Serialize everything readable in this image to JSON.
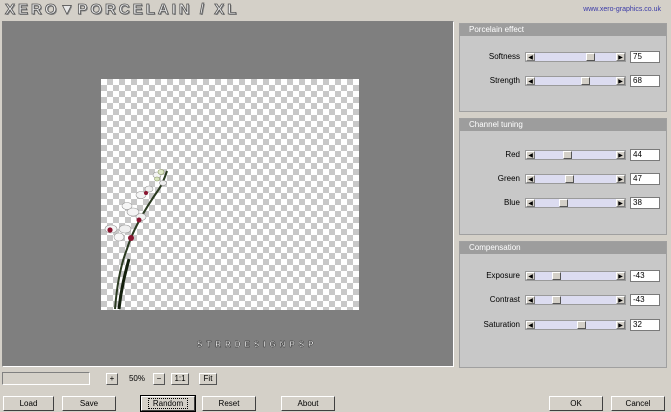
{
  "header": {
    "logo": "XERO▼PORCELAIN / XL",
    "url": "www.xero-graphics.co.uk"
  },
  "preview": {
    "signature": "STRRDESIGNPSP"
  },
  "panels": {
    "porcelain": {
      "title": "Porcelain effect",
      "controls": [
        {
          "label": "Softness",
          "value": "75"
        },
        {
          "label": "Strength",
          "value": "68"
        }
      ]
    },
    "channel": {
      "title": "Channel tuning",
      "controls": [
        {
          "label": "Red",
          "value": "44"
        },
        {
          "label": "Green",
          "value": "47"
        },
        {
          "label": "Blue",
          "value": "38"
        }
      ]
    },
    "compensation": {
      "title": "Compensation",
      "controls": [
        {
          "label": "Exposure",
          "value": "-43"
        },
        {
          "label": "Contrast",
          "value": "-43"
        },
        {
          "label": "Saturation",
          "value": "32"
        }
      ]
    }
  },
  "zoom": {
    "plus": "+",
    "value": "50%",
    "minus": "−",
    "one_to_one": "1:1",
    "fit": "Fit"
  },
  "buttons": {
    "load": "Load",
    "save": "Save",
    "random": "Random",
    "reset": "Reset",
    "about": "About",
    "ok": "OK",
    "cancel": "Cancel"
  },
  "colors": {
    "preview_bg": "#7f7f7f",
    "panel_title_bg": "#9d9d9d",
    "track": "#dcdcf0",
    "url": "#3a3aa8"
  }
}
